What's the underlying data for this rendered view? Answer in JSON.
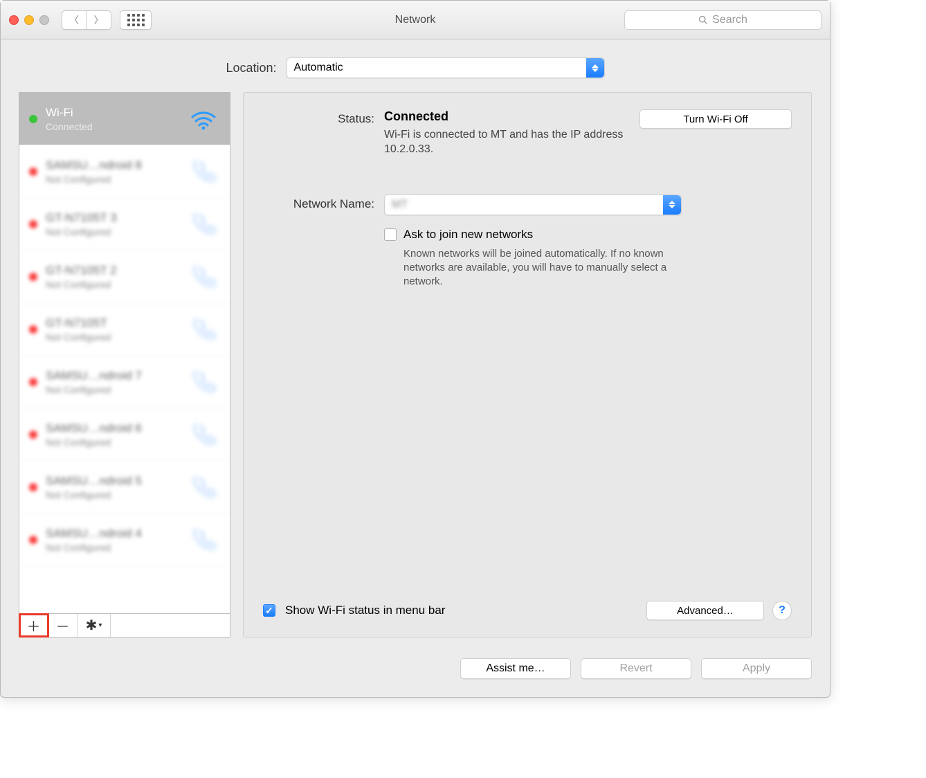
{
  "window": {
    "title": "Network",
    "search_placeholder": "Search"
  },
  "location": {
    "label": "Location:",
    "value": "Automatic"
  },
  "sidebar": {
    "items": [
      {
        "name": "Wi-Fi",
        "status": "Connected",
        "dot": "green",
        "icon": "wifi",
        "selected": true
      },
      {
        "name": "SAMSU…ndroid 8",
        "status": "Not Configured",
        "dot": "red",
        "icon": "phone",
        "blurred": true
      },
      {
        "name": "GT-N7105T 3",
        "status": "Not Configured",
        "dot": "red",
        "icon": "phone",
        "blurred": true
      },
      {
        "name": "GT-N7105T 2",
        "status": "Not Configured",
        "dot": "red",
        "icon": "phone",
        "blurred": true
      },
      {
        "name": "GT-N7105T",
        "status": "Not Configured",
        "dot": "red",
        "icon": "phone",
        "blurred": true
      },
      {
        "name": "SAMSU…ndroid 7",
        "status": "Not Configured",
        "dot": "red",
        "icon": "phone",
        "blurred": true
      },
      {
        "name": "SAMSU…ndroid 6",
        "status": "Not Configured",
        "dot": "red",
        "icon": "phone",
        "blurred": true
      },
      {
        "name": "SAMSU…ndroid 5",
        "status": "Not Configured",
        "dot": "red",
        "icon": "phone",
        "blurred": true
      },
      {
        "name": "SAMSU…ndroid 4",
        "status": "Not Configured",
        "dot": "red",
        "icon": "phone",
        "blurred": true
      }
    ]
  },
  "detail": {
    "status_label": "Status:",
    "status_value": "Connected",
    "status_description": "Wi-Fi is connected to MT and has the IP address 10.2.0.33.",
    "turn_wifi_off": "Turn Wi-Fi Off",
    "network_name_label": "Network Name:",
    "network_name_value": "MT",
    "ask_join_label": "Ask to join new networks",
    "ask_join_help": "Known networks will be joined automatically. If no known networks are available, you will have to manually select a network.",
    "show_status_label": "Show Wi-Fi status in menu bar",
    "advanced_button": "Advanced…"
  },
  "footer": {
    "assist": "Assist me…",
    "revert": "Revert",
    "apply": "Apply"
  }
}
